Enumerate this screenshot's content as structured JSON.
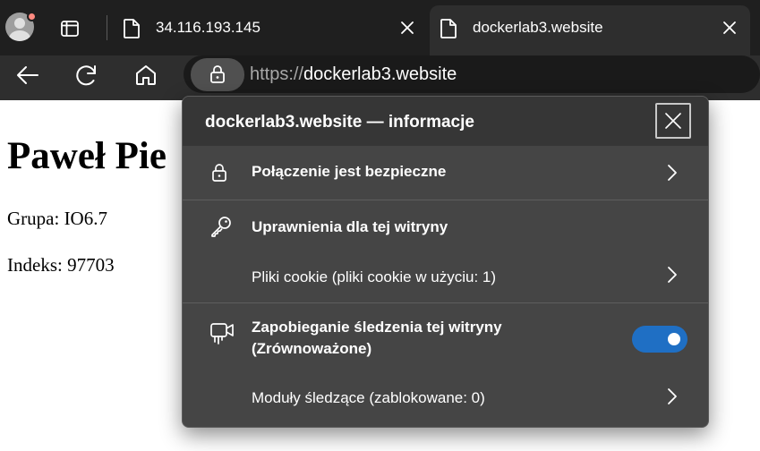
{
  "browser": {
    "tabs": [
      {
        "title": "34.116.193.145"
      },
      {
        "title": "dockerlab3.website"
      }
    ],
    "address_bar": {
      "scheme": "https://",
      "host": "dockerlab3.website"
    }
  },
  "page": {
    "heading": "Paweł Pie",
    "group": "Grupa: IO6.7",
    "index": "Indeks: 97703"
  },
  "site_info_popup": {
    "title": "dockerlab3.website — informacje",
    "connection": "Połączenie jest bezpieczne",
    "permissions": "Uprawnienia dla tej witryny",
    "cookies": "Pliki cookie (pliki cookie w użyciu: 1)",
    "tracking_line1": "Zapobieganie śledzenia tej witryny",
    "tracking_line2": "(Zrównoważone)",
    "tracking_prevention_enabled": true,
    "trackers": "Moduły śledzące (zablokowane: 0)"
  },
  "colors": {
    "toggle_on": "#1f6fc4",
    "popup_bg": "#454545",
    "toolbar_bg": "#2e2e2e"
  }
}
